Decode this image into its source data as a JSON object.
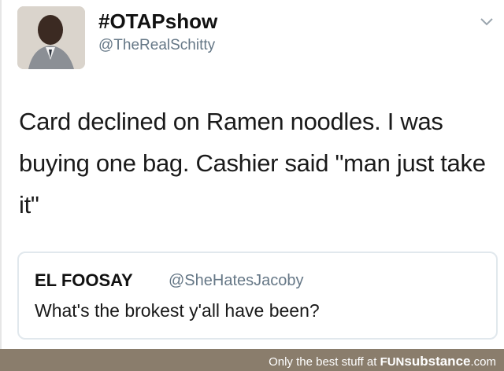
{
  "tweet": {
    "display_name": "#OTAPshow",
    "handle": "@TheRealSchitty",
    "text": "Card declined on Ramen noodles. I was buying one bag. Cashier said \"man just take it\"",
    "menu_icon": "chevron-down-icon"
  },
  "quoted_tweet": {
    "display_name": "EL FOOSAY",
    "handle": "@SheHatesJacoby",
    "text": "What's the brokest y'all have been?"
  },
  "watermark": {
    "prefix": "Only the best stuff at",
    "brand_fun": "FUN",
    "brand_substance": "substance",
    "suffix": ".com"
  },
  "colors": {
    "handle_gray": "#657786",
    "watermark_bar": "#8a7d6c",
    "border": "#e1e8ed"
  }
}
